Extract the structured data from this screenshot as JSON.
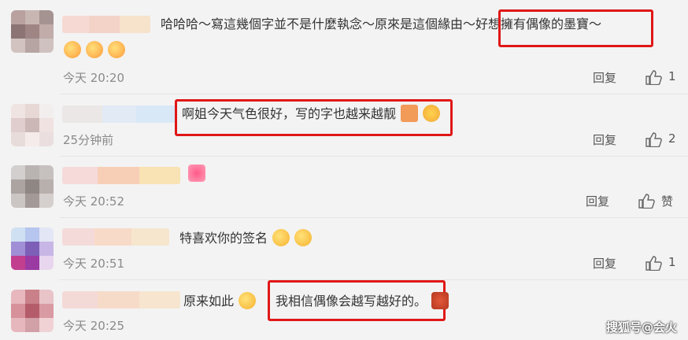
{
  "comments": [
    {
      "pre": "哈哈哈～寫這幾個字並不是什麼執念～原來是這個緣由",
      "hl": "～好想擁有偶像的墨寶～",
      "post": "",
      "time": "今天 20:20",
      "reply": "回复",
      "likes": "1"
    },
    {
      "pre": "",
      "hl": "啊姐今天气色很好，写的字也越来越靓",
      "post": "",
      "time": "25分钟前",
      "reply": "回复",
      "likes": "2"
    },
    {
      "pre": "",
      "hl": "",
      "post": "",
      "time": "今天 20:52",
      "reply": "回复",
      "likes": "赞"
    },
    {
      "pre": "特喜欢你的签名",
      "hl": "",
      "post": "",
      "time": "今天 20:51",
      "reply": "回复",
      "likes": "1"
    },
    {
      "pre": "原来如此",
      "hl": "我相信偶像会越写越好的。",
      "post": "",
      "time": "今天 20:25",
      "reply": "回复",
      "likes": ""
    }
  ],
  "watermark": "搜狐号@会火",
  "icons": {
    "like": "thumbs-up-icon",
    "emoji": "emoji-icon"
  }
}
